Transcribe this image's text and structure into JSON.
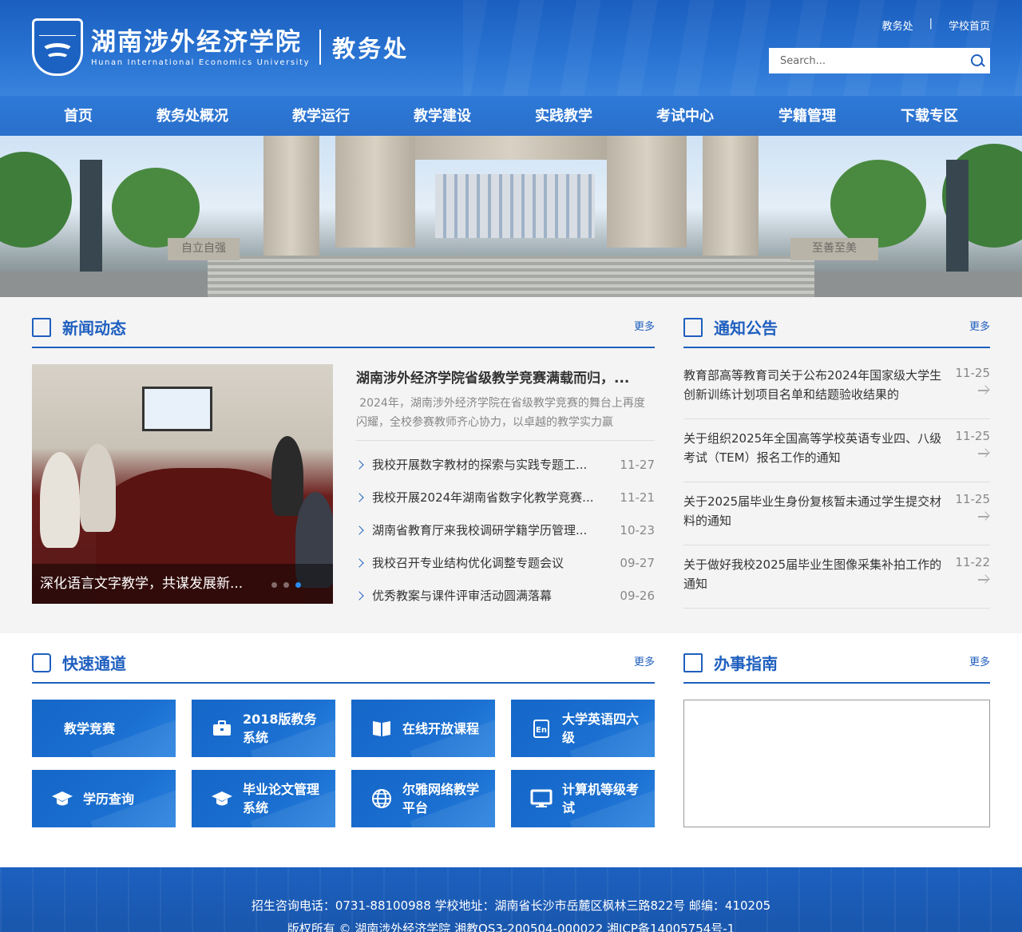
{
  "header": {
    "school_cn": "湖南涉外经济学院",
    "school_en": "Hunan International Economics University",
    "dept": "教务处",
    "top_links": [
      "教务处",
      "学校首页"
    ],
    "search_placeholder": "Search..."
  },
  "nav": [
    "首页",
    "教务处概况",
    "教学运行",
    "教学建设",
    "实践教学",
    "考试中心",
    "学籍管理",
    "下载专区"
  ],
  "banner": {
    "stone_left": "自立自强",
    "stone_right": "至善至美"
  },
  "news": {
    "title": "新闻动态",
    "more": "更多",
    "caption": "深化语言文字教学，共谋发展新...",
    "headline": "湖南涉外经济学院省级教学竞赛满载而归，...",
    "summary": "2024年，湖南涉外经济学院在省级教学竞赛的舞台上再度闪耀，全校参赛教师齐心协力，以卓越的教学实力赢",
    "items": [
      {
        "title": "我校开展数字教材的探索与实践专题工...",
        "date": "11-27"
      },
      {
        "title": "我校开展2024年湖南省数字化教学竞赛...",
        "date": "11-21"
      },
      {
        "title": "湖南省教育厅来我校调研学籍学历管理...",
        "date": "10-23"
      },
      {
        "title": "我校召开专业结构优化调整专题会议",
        "date": "09-27"
      },
      {
        "title": "优秀教案与课件评审活动圆满落幕",
        "date": "09-26"
      }
    ]
  },
  "notices": {
    "title": "通知公告",
    "more": "更多",
    "items": [
      {
        "title": "教育部高等教育司关于公布2024年国家级大学生创新训练计划项目名单和结题验收结果的",
        "date": "11-25"
      },
      {
        "title": "关于组织2025年全国高等学校英语专业四、八级考试（TEM）报名工作的通知",
        "date": "11-25"
      },
      {
        "title": "关于2025届毕业生身份复核暂未通过学生提交材料的通知",
        "date": "11-25"
      },
      {
        "title": "关于做好我校2025届毕业生图像采集补拍工作的通知",
        "date": "11-22"
      }
    ]
  },
  "quick": {
    "title": "快速通道",
    "more": "更多",
    "items": [
      {
        "label": "教学竞赛",
        "icon": "none"
      },
      {
        "label": "2018版教务系统",
        "icon": "briefcase-icon"
      },
      {
        "label": "在线开放课程",
        "icon": "book-icon"
      },
      {
        "label": "大学英语四六级",
        "icon": "english-icon"
      },
      {
        "label": "学历查询",
        "icon": "graduation-cap-icon"
      },
      {
        "label": "毕业论文管理系统",
        "icon": "graduation-cap-icon"
      },
      {
        "label": "尔雅网络教学平台",
        "icon": "globe-icon"
      },
      {
        "label": "计算机等级考试",
        "icon": "monitor-icon"
      }
    ]
  },
  "guide": {
    "title": "办事指南",
    "more": "更多"
  },
  "footer": {
    "line1": "招生咨询电话：0731-88100988 学校地址：湖南省长沙市岳麓区枫林三路822号 邮编：410205",
    "line2": "版权所有 © 湖南涉外经济学院 湘教QS3-200504-000022 湘ICP备14005754号-1"
  },
  "colors": {
    "brand": "#1f5fbf",
    "nav": "#2e7ad8",
    "bg_light": "#f4f4f4"
  }
}
